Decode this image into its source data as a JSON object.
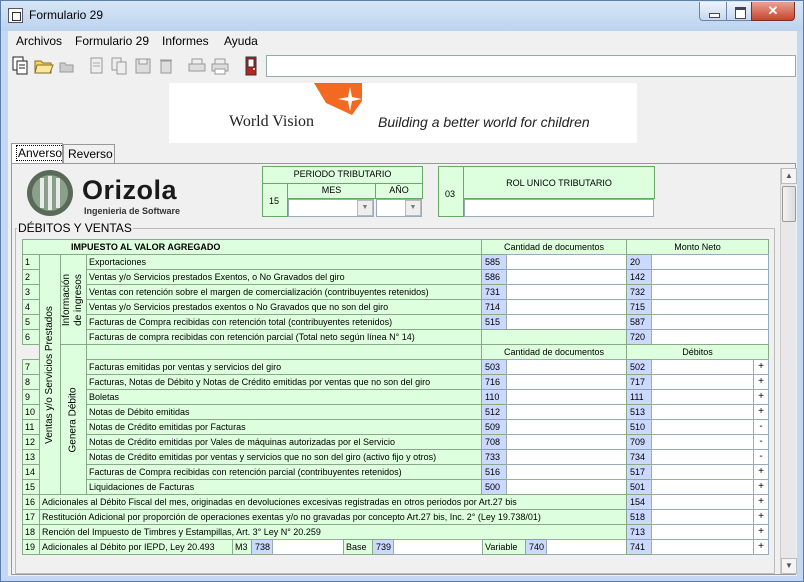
{
  "window": {
    "title": "Formulario 29",
    "close_glyph": "✕"
  },
  "menu": [
    "Archivos",
    "Formulario 29",
    "Informes",
    "Ayuda"
  ],
  "banner": {
    "brand": "World Vision",
    "tagline": "Building a better world for children"
  },
  "tabs": [
    "Anverso",
    "Reverso"
  ],
  "logo": {
    "name": "Orizola",
    "subtitle": "Ingenieria de Software"
  },
  "periodo": {
    "title": "PERIODO TRIBUTARIO",
    "code": "15",
    "mes": "MES",
    "anio": "AÑO"
  },
  "rut": {
    "code": "03",
    "title": "ROL UNICO TRIBUTARIO"
  },
  "section": "DÉBITOS Y VENTAS",
  "table": {
    "header_iva": "IMPUESTO AL VALOR AGREGADO",
    "col_cant": "Cantidad de documentos",
    "col_monto": "Monto Neto",
    "col_debitos": "Débitos",
    "vert_outer": "Ventas y/o Servicios Prestados",
    "vert_info": "Información de ingresos",
    "vert_debito": "Genera Débito",
    "rows_info": [
      {
        "n": "1",
        "label": "Exportaciones",
        "c1": "585",
        "c2": "20"
      },
      {
        "n": "2",
        "label": "Ventas y/o Servicios prestados Exentos, o No Gravados del giro",
        "c1": "586",
        "c2": "142"
      },
      {
        "n": "3",
        "label": "Ventas con retención sobre el margen de comercialización (contribuyentes retenidos)",
        "c1": "731",
        "c2": "732"
      },
      {
        "n": "4",
        "label": "Ventas y/o Servicios prestados exentos o No Gravados que no son del giro",
        "c1": "714",
        "c2": "715"
      },
      {
        "n": "5",
        "label": "Facturas de Compra recibidas con retención total (contribuyentes retenidos)",
        "c1": "515",
        "c2": "587"
      },
      {
        "n": "6",
        "label": "Facturas de compra recibidas con retención parcial (Total neto según línea N° 14)",
        "c1": "",
        "c2": "720"
      }
    ],
    "rows_debito": [
      {
        "n": "7",
        "label": "Facturas emitidas por ventas y servicios del giro",
        "c1": "503",
        "c2": "502",
        "s": "+"
      },
      {
        "n": "8",
        "label": "Facturas, Notas de Débito y Notas de Crédito emitidas por ventas que no son del giro",
        "c1": "716",
        "c2": "717",
        "s": "+"
      },
      {
        "n": "9",
        "label": "Boletas",
        "c1": "110",
        "c2": "111",
        "s": "+"
      },
      {
        "n": "10",
        "label": "Notas de Débito emitidas",
        "c1": "512",
        "c2": "513",
        "s": "+"
      },
      {
        "n": "11",
        "label": "Notas de Crédito emitidas por Facturas",
        "c1": "509",
        "c2": "510",
        "s": "-"
      },
      {
        "n": "12",
        "label": "Notas de Crédito emitidas por Vales de máquinas autorizadas por el Servicio",
        "c1": "708",
        "c2": "709",
        "s": "-"
      },
      {
        "n": "13",
        "label": "Notas de Crédito emitidas por ventas y servicios que no son del giro (activo fijo y otros)",
        "c1": "733",
        "c2": "734",
        "s": "-"
      },
      {
        "n": "14",
        "label": "Facturas de Compra recibidas con retención parcial (contribuyentes retenidos)",
        "c1": "516",
        "c2": "517",
        "s": "+"
      },
      {
        "n": "15",
        "label": "Liquidaciones de Facturas",
        "c1": "500",
        "c2": "501",
        "s": "+"
      }
    ],
    "rows_extra": [
      {
        "n": "16",
        "label": "Adicionales al Débito Fiscal del mes, originadas en devoluciones excesivas registradas en otros periodos por Art.27 bis",
        "c2": "154",
        "s": "+"
      },
      {
        "n": "17",
        "label": "Restitución Adicional por proporción de operaciones exentas y/o no gravadas por concepto Art.27 bis, Inc. 2° (Ley 19.738/01)",
        "c2": "518",
        "s": "+"
      },
      {
        "n": "18",
        "label": "Rención del Impuesto de Timbres y Estampillas, Art. 3° Ley N° 20.259",
        "c2": "713",
        "s": "+"
      }
    ],
    "row19": {
      "n": "19",
      "label": "Adicionales al Débito por IEPD, Ley 20.493",
      "m3": "M3",
      "c_m3": "738",
      "base": "Base",
      "c_base": "739",
      "variable": "Variable",
      "c_var": "740",
      "c2": "741",
      "s": "+"
    }
  }
}
